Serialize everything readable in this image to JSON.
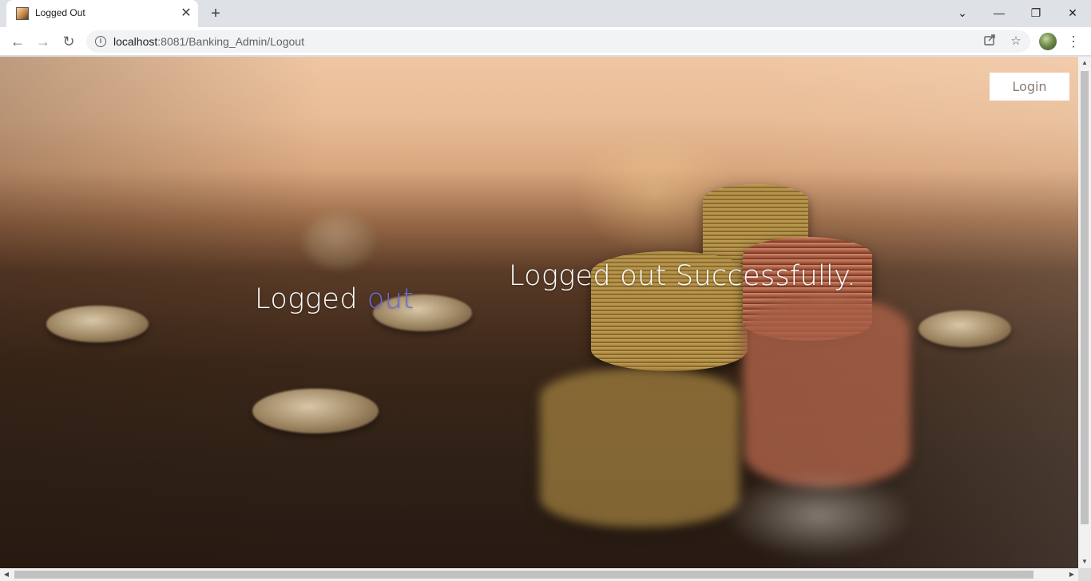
{
  "browser": {
    "tab_title": "Logged Out",
    "tab_close": "✕",
    "new_tab": "+",
    "url_host": "localhost",
    "url_path": ":8081/Banking_Admin/Logout",
    "window_controls": {
      "dropdown": "⌄",
      "minimize": "—",
      "restore": "❐",
      "close": "✕"
    },
    "nav": {
      "back": "←",
      "forward": "→",
      "reload": "↻"
    },
    "icons": [
      "info-icon",
      "share-icon",
      "star-icon",
      "profile-avatar",
      "menu-icon"
    ]
  },
  "page": {
    "login_label": "Login",
    "heading_main": "Logged ",
    "heading_accent": "out",
    "message": "Logged out Successfully.",
    "accent_color": "#6b6bd8"
  }
}
